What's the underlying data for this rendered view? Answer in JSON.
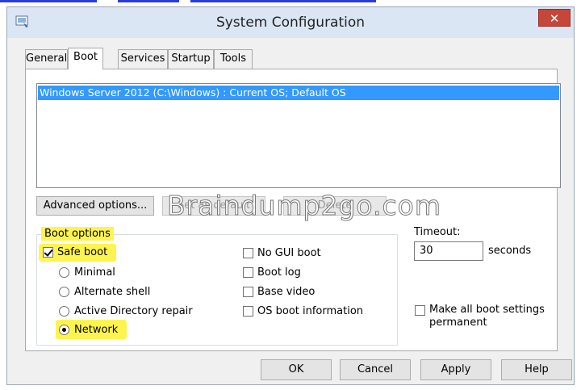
{
  "window": {
    "title": "System Configuration",
    "close_label": "✕"
  },
  "tabs": [
    {
      "label": "General"
    },
    {
      "label": "Boot"
    },
    {
      "label": "Services"
    },
    {
      "label": "Startup"
    },
    {
      "label": "Tools"
    }
  ],
  "boot": {
    "os_entries": [
      "Windows Server 2012 (C:\\Windows) : Current OS; Default OS"
    ],
    "buttons": {
      "advanced": "Advanced options...",
      "set_default": "Set as default",
      "delete": "Delete"
    },
    "options_label": "Boot options",
    "safe_boot": {
      "label": "Safe boot",
      "checked": true
    },
    "safe_boot_modes": [
      {
        "label": "Minimal",
        "selected": false
      },
      {
        "label": "Alternate shell",
        "selected": false
      },
      {
        "label": "Active Directory repair",
        "selected": false
      },
      {
        "label": "Network",
        "selected": true
      }
    ],
    "extra_options": [
      {
        "label": "No GUI boot",
        "checked": false
      },
      {
        "label": "Boot log",
        "checked": false
      },
      {
        "label": "Base video",
        "checked": false
      },
      {
        "label": "OS boot information",
        "checked": false
      }
    ],
    "timeout": {
      "label": "Timeout:",
      "value": "30",
      "unit": "seconds"
    },
    "permanent": {
      "label_line1": "Make all boot settings",
      "label_line2": "permanent",
      "checked": false
    }
  },
  "dialog_buttons": {
    "ok": "OK",
    "cancel": "Cancel",
    "apply": "Apply",
    "help": "Help"
  },
  "watermark": "Braindump2go.com",
  "colors": {
    "selection": "#3399ff",
    "highlight": "#fff44f",
    "close": "#c7463a"
  }
}
